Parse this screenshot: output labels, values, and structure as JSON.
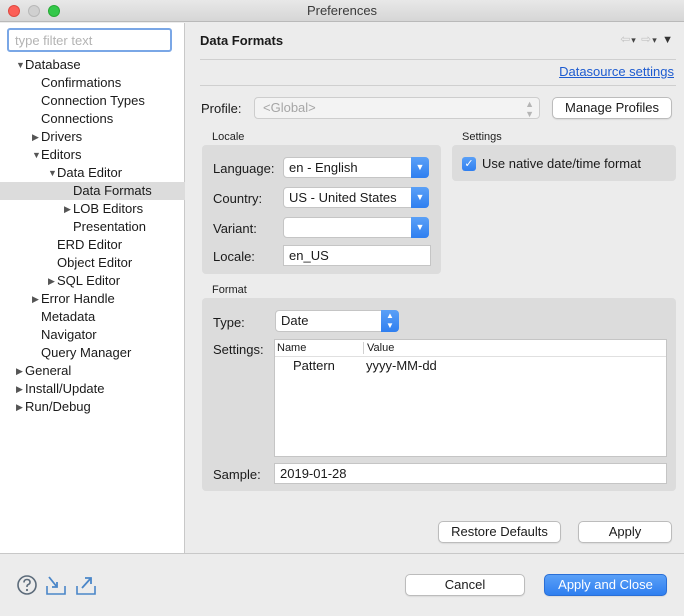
{
  "window": {
    "title": "Preferences"
  },
  "filter": {
    "placeholder": "type filter text"
  },
  "tree": [
    {
      "label": "Database",
      "level": 0,
      "twisty": "open"
    },
    {
      "label": "Confirmations",
      "level": 1,
      "twisty": "none"
    },
    {
      "label": "Connection Types",
      "level": 1,
      "twisty": "none"
    },
    {
      "label": "Connections",
      "level": 1,
      "twisty": "none"
    },
    {
      "label": "Drivers",
      "level": 1,
      "twisty": "closed"
    },
    {
      "label": "Editors",
      "level": 1,
      "twisty": "open"
    },
    {
      "label": "Data Editor",
      "level": 2,
      "twisty": "open"
    },
    {
      "label": "Data Formats",
      "level": 3,
      "twisty": "none",
      "selected": true
    },
    {
      "label": "LOB Editors",
      "level": 3,
      "twisty": "closed"
    },
    {
      "label": "Presentation",
      "level": 3,
      "twisty": "none"
    },
    {
      "label": "ERD Editor",
      "level": 2,
      "twisty": "none"
    },
    {
      "label": "Object Editor",
      "level": 2,
      "twisty": "none"
    },
    {
      "label": "SQL Editor",
      "level": 2,
      "twisty": "closed"
    },
    {
      "label": "Error Handle",
      "level": 1,
      "twisty": "closed"
    },
    {
      "label": "Metadata",
      "level": 1,
      "twisty": "none"
    },
    {
      "label": "Navigator",
      "level": 1,
      "twisty": "none"
    },
    {
      "label": "Query Manager",
      "level": 1,
      "twisty": "none"
    },
    {
      "label": "General",
      "level": 0,
      "twisty": "closed"
    },
    {
      "label": "Install/Update",
      "level": 0,
      "twisty": "closed"
    },
    {
      "label": "Run/Debug",
      "level": 0,
      "twisty": "closed"
    }
  ],
  "page": {
    "title": "Data Formats",
    "datasource_link": "Datasource settings",
    "profile_label": "Profile:",
    "profile_value": "<Global>",
    "manage_profiles": "Manage Profiles"
  },
  "locale": {
    "title": "Locale",
    "language_label": "Language:",
    "language_value": "en - English",
    "country_label": "Country:",
    "country_value": "US - United States",
    "variant_label": "Variant:",
    "variant_value": "",
    "locale_label": "Locale:",
    "locale_value": "en_US"
  },
  "settings": {
    "title": "Settings",
    "native_label": "Use native date/time format",
    "native_checked": true
  },
  "format": {
    "title": "Format",
    "type_label": "Type:",
    "type_value": "Date",
    "settings_label": "Settings:",
    "columns": [
      "Name",
      "Value"
    ],
    "rows": [
      {
        "name": "Pattern",
        "value": "yyyy-MM-dd"
      }
    ],
    "sample_label": "Sample:",
    "sample_value": "2019-01-28"
  },
  "actions": {
    "restore_defaults": "Restore Defaults",
    "apply": "Apply",
    "cancel": "Cancel",
    "apply_and_close": "Apply and Close"
  },
  "icons": {
    "help": "help-icon",
    "import": "import-icon",
    "export": "export-icon",
    "back": "back-arrow-icon",
    "forward": "forward-arrow-icon",
    "menu": "view-menu-icon"
  },
  "colors": {
    "accent": "#2f7ff0",
    "link": "#1d5bd0",
    "selection": "#dcdcdc"
  }
}
